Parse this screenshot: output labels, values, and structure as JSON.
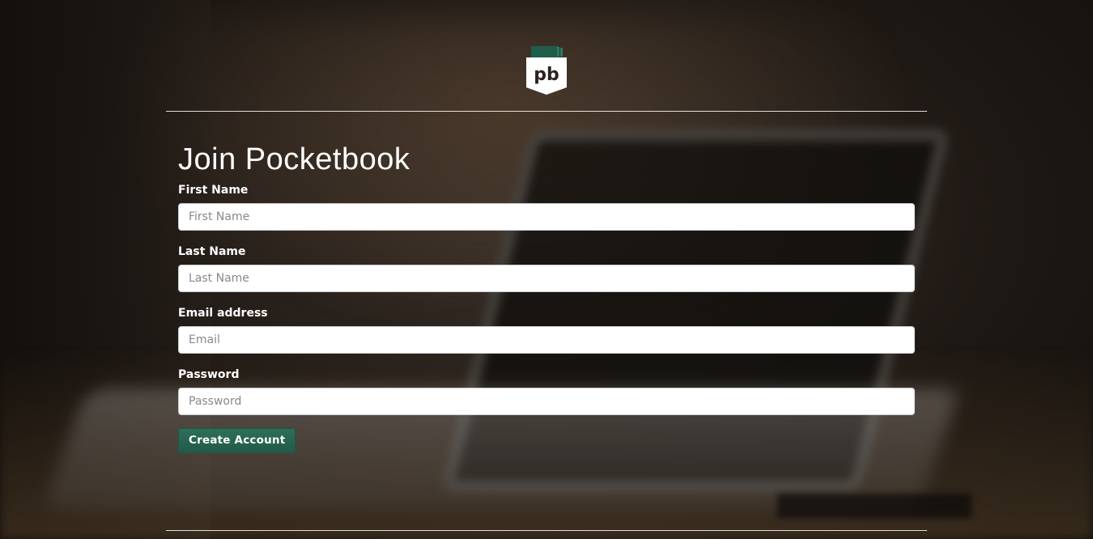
{
  "brand": {
    "logo_text": "pb",
    "accent_color": "#236b55"
  },
  "form": {
    "title": "Join Pocketbook",
    "fields": [
      {
        "label": "First Name",
        "placeholder": "First Name",
        "value": ""
      },
      {
        "label": "Last Name",
        "placeholder": "Last Name",
        "value": ""
      },
      {
        "label": "Email address",
        "placeholder": "Email",
        "value": ""
      },
      {
        "label": "Password",
        "placeholder": "Password",
        "value": ""
      }
    ],
    "submit_label": "Create Account"
  }
}
